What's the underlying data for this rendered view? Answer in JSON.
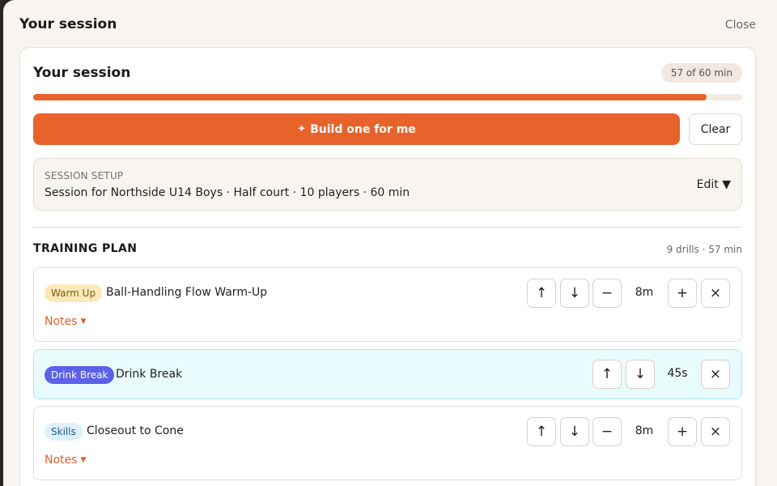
{
  "header": {
    "title": "Your session",
    "close_label": "Close"
  },
  "session": {
    "title": "Your session",
    "time_badge": "57 of 60 min",
    "progress_percent": 95,
    "build_label": "Build one for me",
    "build_icon": "✦",
    "clear_label": "Clear"
  },
  "setup": {
    "label": "SESSION SETUP",
    "summary": "Session for Northside U14 Boys · Half court · 10 players · 60 min",
    "edit_label": "Edit ▼"
  },
  "plan": {
    "title": "TRAINING PLAN",
    "meta": "9 drills · 57 min",
    "notes_label": "Notes",
    "drills": [
      {
        "tag": "Warm Up",
        "name": "Ball-Handling Flow Warm-Up",
        "duration": "8m"
      },
      {
        "tag": "Drink Break",
        "name": "Drink Break",
        "duration": "45s"
      },
      {
        "tag": "Skills",
        "name": "Closeout to Cone",
        "duration": "8m"
      }
    ]
  },
  "icons": {
    "up": "↑",
    "down": "↓",
    "minus": "−",
    "plus": "+",
    "remove": "×",
    "caret": "▼"
  },
  "colors": {
    "accent": "#e8622c",
    "drink_tag": "#5b61e8",
    "break_bg": "#e8fbfd"
  }
}
